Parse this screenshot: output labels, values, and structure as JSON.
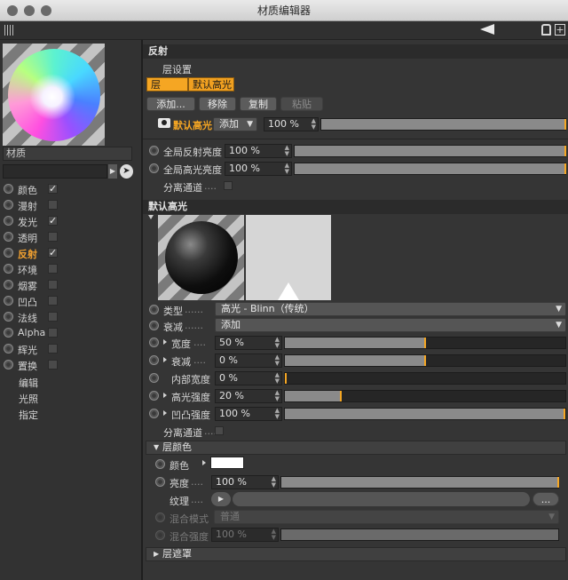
{
  "window": {
    "title": "材质编辑器"
  },
  "material": {
    "name": "材质"
  },
  "channels": [
    {
      "label": "颜色",
      "checked": true
    },
    {
      "label": "漫射",
      "checked": false
    },
    {
      "label": "发光",
      "checked": true
    },
    {
      "label": "透明",
      "checked": false
    },
    {
      "label": "反射",
      "checked": true,
      "active": true
    },
    {
      "label": "环境",
      "checked": false
    },
    {
      "label": "烟雾",
      "checked": false
    },
    {
      "label": "凹凸",
      "checked": false
    },
    {
      "label": "法线",
      "checked": false
    },
    {
      "label": "Alpha",
      "checked": false
    },
    {
      "label": "辉光",
      "checked": false
    },
    {
      "label": "置换",
      "checked": false
    }
  ],
  "extras": [
    "编辑",
    "光照",
    "指定"
  ],
  "reflection": {
    "header": "反射",
    "layer_settings": "层设置",
    "tab_layers": "层",
    "tab_default_spec": "默认高光",
    "btn_add": "添加...",
    "btn_remove": "移除",
    "btn_copy": "复制",
    "btn_paste": "粘贴",
    "layer_name": "默认高光",
    "layer_mode": "添加",
    "layer_strength": "100 %",
    "global_refl_label": "全局反射亮度",
    "global_refl_value": "100 %",
    "global_spec_label": "全局高光亮度",
    "global_spec_value": "100 %",
    "separate_pass": "分离通道",
    "dots": "...."
  },
  "spec": {
    "header": "默认高光",
    "type_label": "类型",
    "type_value": "高光 - Blinn（传统）",
    "falloff_label": "衰减",
    "falloff_value": "添加",
    "width_label": "宽度",
    "width_value": "50 %",
    "width_frac": 0.5,
    "decay_label": "衰减",
    "decay_value": "0 %",
    "decay_frac": 0.5,
    "inner_label": "内部宽度",
    "inner_value": "0 %",
    "inner_frac": 0.0,
    "strength_label": "高光强度",
    "strength_value": "20 %",
    "strength_frac": 0.2,
    "bump_label": "凹凸强度",
    "bump_value": "100 %",
    "bump_frac": 1.0,
    "separate_pass": "分离通道",
    "dots": "......"
  },
  "layer_color": {
    "header": "层颜色",
    "color_label": "颜色",
    "color_swatch": "#ffffff",
    "brightness_label": "亮度",
    "brightness_value": "100 %",
    "texture_label": "纹理",
    "texture_more": "...",
    "blend_mode_label": "混合模式",
    "blend_mode_value": "普通",
    "blend_strength_label": "混合强度",
    "blend_strength_value": "100 %",
    "dots": "...."
  },
  "layer_mask": {
    "header": "层遮罩"
  },
  "colors": {
    "accent": "#f5a623",
    "panel": "#353535"
  }
}
